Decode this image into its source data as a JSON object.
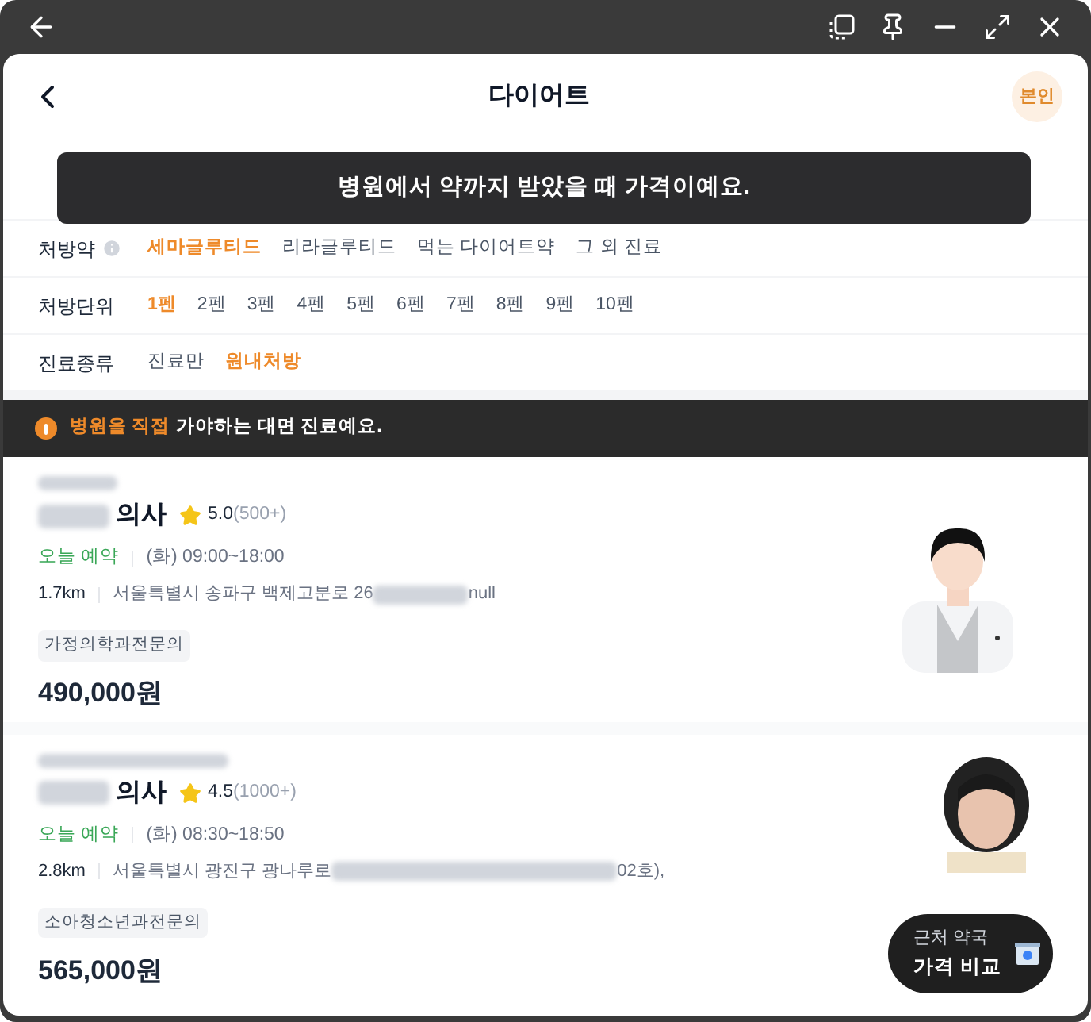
{
  "header": {
    "title": "다이어트",
    "badge": "본인"
  },
  "toast": {
    "text": "병원에서 약까지 받았을 때 가격이예요."
  },
  "filters": [
    {
      "label": "처방약",
      "info": true,
      "options": [
        {
          "label": "세마글루티드",
          "selected": true
        },
        {
          "label": "리라글루티드",
          "selected": false
        },
        {
          "label": "먹는 다이어트약",
          "selected": false
        },
        {
          "label": "그 외 진료",
          "selected": false
        }
      ]
    },
    {
      "label": "처방단위",
      "info": false,
      "options": [
        {
          "label": "1펜",
          "selected": true
        },
        {
          "label": "2펜",
          "selected": false
        },
        {
          "label": "3펜",
          "selected": false
        },
        {
          "label": "4펜",
          "selected": false
        },
        {
          "label": "5펜",
          "selected": false
        },
        {
          "label": "6펜",
          "selected": false
        },
        {
          "label": "7펜",
          "selected": false
        },
        {
          "label": "8펜",
          "selected": false
        },
        {
          "label": "9펜",
          "selected": false
        },
        {
          "label": "10펜",
          "selected": false
        }
      ]
    },
    {
      "label": "진료종류",
      "info": false,
      "options": [
        {
          "label": "진료만",
          "selected": false
        },
        {
          "label": "원내처방",
          "selected": true
        }
      ]
    }
  ],
  "notice": {
    "highlight": "병원을 직접",
    "text": "가야하는 대면 진료예요."
  },
  "doctors": [
    {
      "title": "의사",
      "rating": "5.0",
      "reviews": "(500+)",
      "booking": "오늘 예약",
      "hours": "(화) 09:00~18:00",
      "distance": "1.7km",
      "address_start": "서울특별시 송파구 백제고분로 26",
      "address_end": "null",
      "specialty": "가정의학과전문의",
      "price": "490,000원",
      "avatar": {
        "kind": "illustration"
      }
    },
    {
      "title": "의사",
      "rating": "4.5",
      "reviews": "(1000+)",
      "booking": "오늘 예약",
      "hours": "(화) 08:30~18:50",
      "distance": "2.8km",
      "address_start": "서울특별시 광진구 광나루로",
      "address_end": "02호),",
      "specialty": "소아청소년과전문의",
      "price": "565,000원"
    }
  ],
  "fab": {
    "line1": "근처 약국",
    "line2": "가격 비교"
  }
}
